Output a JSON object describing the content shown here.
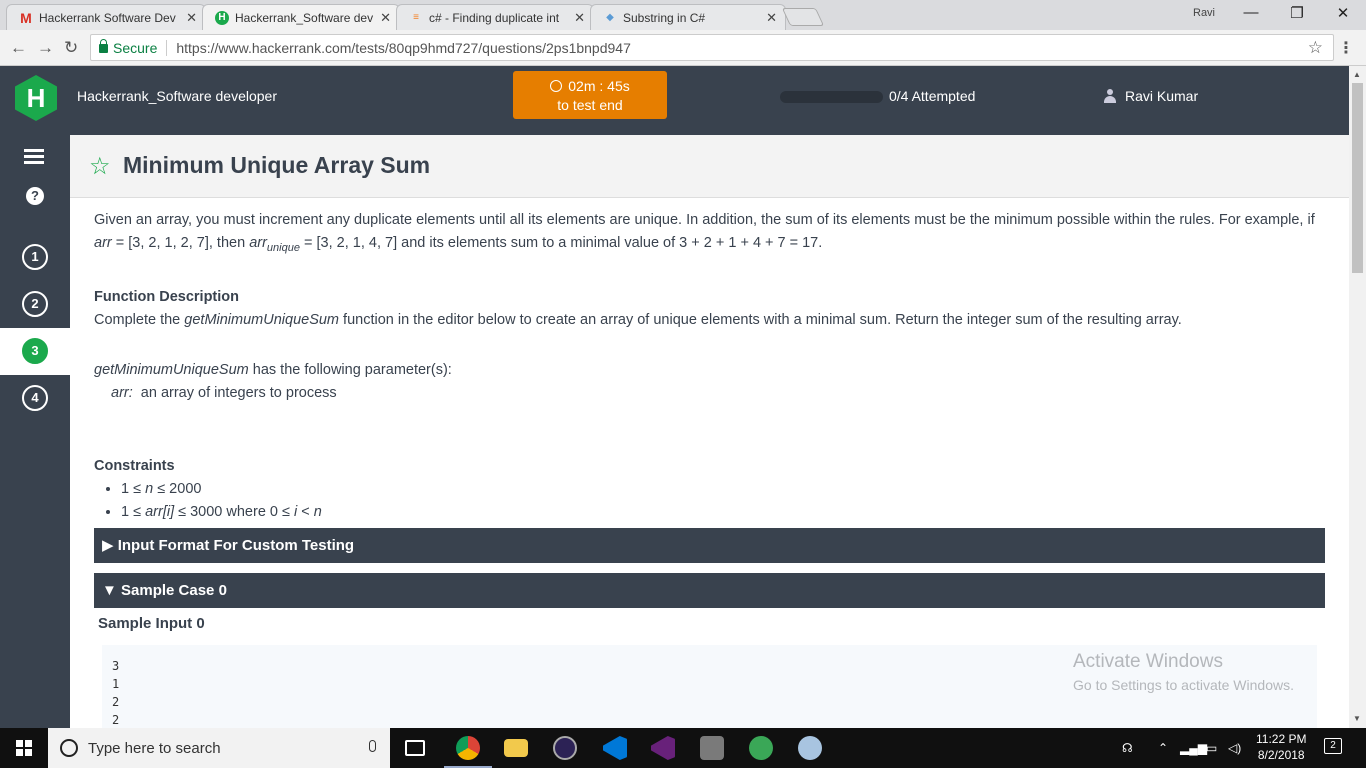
{
  "browser": {
    "tabs": [
      {
        "title": "Hackerrank Software Dev",
        "favicon": "gmail-icon"
      },
      {
        "title": "Hackerrank_Software dev",
        "favicon": "hackerrank-icon"
      },
      {
        "title": "c# - Finding duplicate int",
        "favicon": "stackoverflow-icon"
      },
      {
        "title": "Substring in C#",
        "favicon": "doc-icon"
      }
    ],
    "profile_name": "Ravi",
    "secure_label": "Secure",
    "url": "https://www.hackerrank.com/tests/80qp9hmd727/questions/2ps1bnpd947"
  },
  "header": {
    "logo_letter": "H",
    "test_name": "Hackerrank_Software developer",
    "timer_value": "02m : 45s",
    "timer_label": "to test end",
    "progress_fraction": 0,
    "attempted": "0/4 Attempted",
    "user_name": "Ravi Kumar"
  },
  "sidebar": {
    "help_label": "?",
    "questions": [
      "1",
      "2",
      "3",
      "4"
    ],
    "active_question": "3"
  },
  "problem": {
    "title": "Minimum Unique Array Sum",
    "intro_1": "Given an array, you must increment any duplicate elements until all its elements are unique. In addition, the sum of its elements must be the minimum possible within the rules. For example, if ",
    "arr_var": "arr",
    "intro_2": " = [3, 2, 1, 2, 7], then ",
    "arr_unique_var": "arr",
    "unique_sub": "unique",
    "intro_3": " = [3, 2, 1, 4, 7] and its elements sum to a minimal value of 3 + 2 + 1 + 4 + 7 = 17.",
    "func_desc_heading": "Function Description",
    "func_desc_1": "Complete the ",
    "func_name": "getMinimumUniqueSum",
    "func_desc_2": " function in the editor below to create an array of unique elements with a minimal sum. Return the integer sum of the resulting array.",
    "params_func": "getMinimumUniqueSum",
    "params_text": " has the following parameter(s):",
    "param_name": "arr:",
    "param_desc": "  an array of integers to process",
    "constraints_heading": "Constraints",
    "constraint_1_a": "1 ≤ ",
    "constraint_1_var": "n",
    "constraint_1_b": " ≤ 2000",
    "constraint_2_a": "1 ≤ ",
    "constraint_2_var": "arr[i]",
    "constraint_2_b": " ≤ 3000 where 0 ≤ ",
    "constraint_2_i": "i",
    "constraint_2_c": " < ",
    "constraint_2_n": "n",
    "input_format_section": "Input Format For Custom Testing",
    "sample_case_section": "Sample Case 0",
    "sample_input_heading": "Sample Input 0",
    "sample_input_lines": [
      "3",
      "1",
      "2",
      "2"
    ]
  },
  "watermark": {
    "line1": "Activate Windows",
    "line2": "Go to Settings to activate Windows."
  },
  "taskbar": {
    "search_placeholder": "Type here to search",
    "time": "11:22 PM",
    "date": "8/2/2018",
    "notification_count": "2"
  }
}
